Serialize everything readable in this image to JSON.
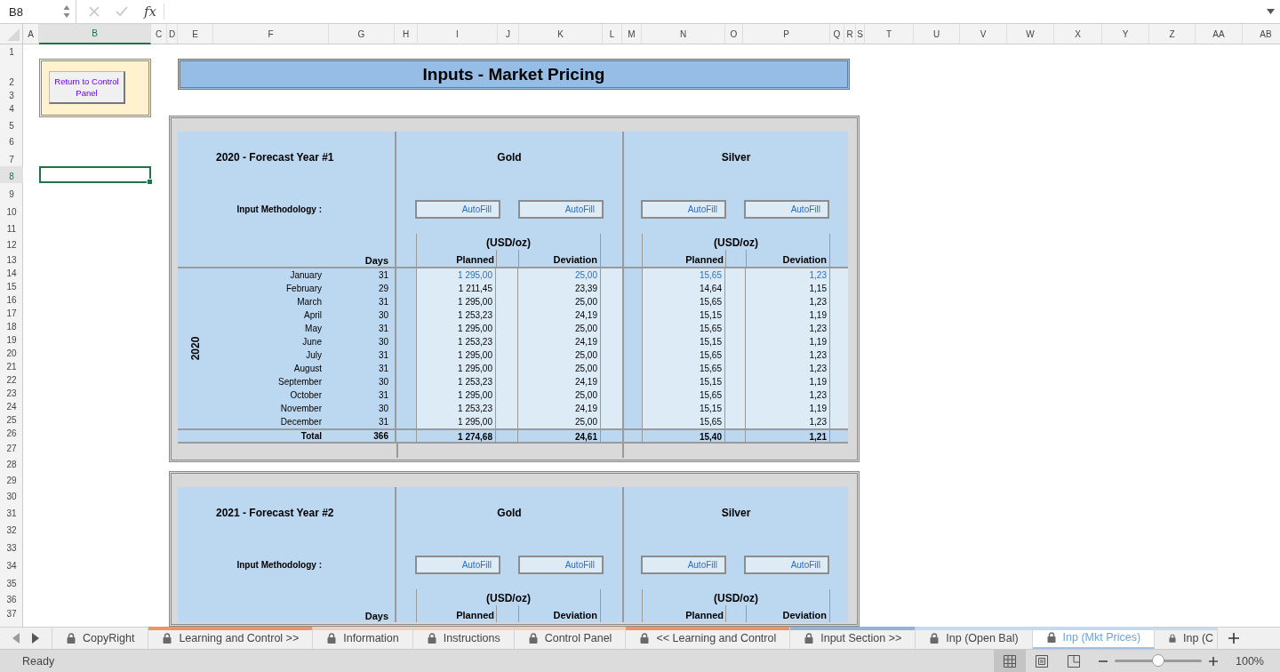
{
  "formula_bar": {
    "name_box": "B8",
    "function_label": "fx"
  },
  "columns": [
    {
      "label": "A",
      "selected": false
    },
    {
      "label": "B",
      "selected": true
    },
    {
      "label": "C",
      "selected": false
    },
    {
      "label": "D",
      "selected": false
    },
    {
      "label": "E",
      "selected": false
    },
    {
      "label": "F",
      "selected": false
    },
    {
      "label": "G",
      "selected": false
    },
    {
      "label": "H",
      "selected": false
    },
    {
      "label": "I",
      "selected": false
    },
    {
      "label": "J",
      "selected": false
    },
    {
      "label": "K",
      "selected": false
    },
    {
      "label": "L",
      "selected": false
    },
    {
      "label": "M",
      "selected": false
    },
    {
      "label": "N",
      "selected": false
    },
    {
      "label": "O",
      "selected": false
    },
    {
      "label": "P",
      "selected": false
    },
    {
      "label": "Q",
      "selected": false
    },
    {
      "label": "R",
      "selected": false
    },
    {
      "label": "S",
      "selected": false
    },
    {
      "label": "T",
      "selected": false
    },
    {
      "label": "U",
      "selected": false
    },
    {
      "label": "V",
      "selected": false
    },
    {
      "label": "W",
      "selected": false
    },
    {
      "label": "X",
      "selected": false
    },
    {
      "label": "Y",
      "selected": false
    },
    {
      "label": "Z",
      "selected": false
    },
    {
      "label": "AA",
      "selected": false
    },
    {
      "label": "AB",
      "selected": false
    }
  ],
  "rows": [
    {
      "label": "1",
      "selected": false
    },
    {
      "label": "2",
      "selected": false
    },
    {
      "label": "3",
      "selected": false
    },
    {
      "label": "4",
      "selected": false
    },
    {
      "label": "5",
      "selected": false
    },
    {
      "label": "6",
      "selected": false
    },
    {
      "label": "7",
      "selected": false
    },
    {
      "label": "8",
      "selected": true
    },
    {
      "label": "9",
      "selected": false
    },
    {
      "label": "10",
      "selected": false
    },
    {
      "label": "11",
      "selected": false
    },
    {
      "label": "12",
      "selected": false
    },
    {
      "label": "13",
      "selected": false
    },
    {
      "label": "14",
      "selected": false
    },
    {
      "label": "15",
      "selected": false
    },
    {
      "label": "16",
      "selected": false
    },
    {
      "label": "17",
      "selected": false
    },
    {
      "label": "18",
      "selected": false
    },
    {
      "label": "19",
      "selected": false
    },
    {
      "label": "20",
      "selected": false
    },
    {
      "label": "21",
      "selected": false
    },
    {
      "label": "22",
      "selected": false
    },
    {
      "label": "23",
      "selected": false
    },
    {
      "label": "24",
      "selected": false
    },
    {
      "label": "25",
      "selected": false
    },
    {
      "label": "26",
      "selected": false
    },
    {
      "label": "27",
      "selected": false
    },
    {
      "label": "28",
      "selected": false
    },
    {
      "label": "29",
      "selected": false
    },
    {
      "label": "30",
      "selected": false
    },
    {
      "label": "31",
      "selected": false
    },
    {
      "label": "32",
      "selected": false
    },
    {
      "label": "33",
      "selected": false
    },
    {
      "label": "34",
      "selected": false
    },
    {
      "label": "35",
      "selected": false
    },
    {
      "label": "36",
      "selected": false
    },
    {
      "label": "37",
      "selected": false
    }
  ],
  "return_button": "Return to Control Panel",
  "title": "Inputs - Market Pricing",
  "blocks": [
    {
      "title": "2020 - Forecast Year #1",
      "methodology_label": "Input Methodology :",
      "days_label": "Days",
      "year_label": "2020",
      "metals": [
        {
          "name": "Gold",
          "autofill": [
            "AutoFill",
            "AutoFill"
          ],
          "unit": "(USD/oz)",
          "columns": [
            "Planned",
            "Deviation"
          ]
        },
        {
          "name": "Silver",
          "autofill": [
            "AutoFill",
            "AutoFill"
          ],
          "unit": "(USD/oz)",
          "columns": [
            "Planned",
            "Deviation"
          ]
        }
      ],
      "rows": [
        {
          "month": "January",
          "days": "31",
          "is_input": true,
          "values": [
            [
              "1 295,00",
              "25,00"
            ],
            [
              "15,65",
              "1,23"
            ]
          ]
        },
        {
          "month": "February",
          "days": "29",
          "is_input": false,
          "values": [
            [
              "1 211,45",
              "23,39"
            ],
            [
              "14,64",
              "1,15"
            ]
          ]
        },
        {
          "month": "March",
          "days": "31",
          "is_input": false,
          "values": [
            [
              "1 295,00",
              "25,00"
            ],
            [
              "15,65",
              "1,23"
            ]
          ]
        },
        {
          "month": "April",
          "days": "30",
          "is_input": false,
          "values": [
            [
              "1 253,23",
              "24,19"
            ],
            [
              "15,15",
              "1,19"
            ]
          ]
        },
        {
          "month": "May",
          "days": "31",
          "is_input": false,
          "values": [
            [
              "1 295,00",
              "25,00"
            ],
            [
              "15,65",
              "1,23"
            ]
          ]
        },
        {
          "month": "June",
          "days": "30",
          "is_input": false,
          "values": [
            [
              "1 253,23",
              "24,19"
            ],
            [
              "15,15",
              "1,19"
            ]
          ]
        },
        {
          "month": "July",
          "days": "31",
          "is_input": false,
          "values": [
            [
              "1 295,00",
              "25,00"
            ],
            [
              "15,65",
              "1,23"
            ]
          ]
        },
        {
          "month": "August",
          "days": "31",
          "is_input": false,
          "values": [
            [
              "1 295,00",
              "25,00"
            ],
            [
              "15,65",
              "1,23"
            ]
          ]
        },
        {
          "month": "September",
          "days": "30",
          "is_input": false,
          "values": [
            [
              "1 253,23",
              "24,19"
            ],
            [
              "15,15",
              "1,19"
            ]
          ]
        },
        {
          "month": "October",
          "days": "31",
          "is_input": false,
          "values": [
            [
              "1 295,00",
              "25,00"
            ],
            [
              "15,65",
              "1,23"
            ]
          ]
        },
        {
          "month": "November",
          "days": "30",
          "is_input": false,
          "values": [
            [
              "1 253,23",
              "24,19"
            ],
            [
              "15,15",
              "1,19"
            ]
          ]
        },
        {
          "month": "December",
          "days": "31",
          "is_input": false,
          "values": [
            [
              "1 295,00",
              "25,00"
            ],
            [
              "15,65",
              "1,23"
            ]
          ]
        }
      ],
      "total": {
        "label": "Total",
        "days": "366",
        "values": [
          [
            "1 274,68",
            "24,61"
          ],
          [
            "15,40",
            "1,21"
          ]
        ]
      }
    },
    {
      "title": "2021 - Forecast Year #2",
      "methodology_label": "Input Methodology :",
      "days_label": "Days",
      "metals": [
        {
          "name": "Gold",
          "autofill": [
            "AutoFill",
            "AutoFill"
          ],
          "unit": "(USD/oz)",
          "columns": [
            "Planned",
            "Deviation"
          ]
        },
        {
          "name": "Silver",
          "autofill": [
            "AutoFill",
            "AutoFill"
          ],
          "unit": "(USD/oz)",
          "columns": [
            "Planned",
            "Deviation"
          ]
        }
      ]
    }
  ],
  "tabs": [
    {
      "label": "CopyRight",
      "selected": false
    },
    {
      "label": "Learning and Control >>",
      "selected": false,
      "color": "#e8956a"
    },
    {
      "label": "Information",
      "selected": false,
      "color": "#f6cdb6"
    },
    {
      "label": "Instructions",
      "selected": false,
      "color": "#f6cdb6"
    },
    {
      "label": "Control Panel",
      "selected": false,
      "color": "#f6cdb6"
    },
    {
      "label": "<< Learning and Control",
      "selected": false,
      "color": "#e8956a"
    },
    {
      "label": "Input Section >>",
      "selected": false,
      "color": "#8fb3d9"
    },
    {
      "label": "Inp (Open Bal)",
      "selected": false,
      "color": "#c6daef"
    },
    {
      "label": "Inp (Mkt Prices)",
      "selected": true,
      "color": "#c6daef"
    },
    {
      "label": "Inp (C",
      "selected": false,
      "color": "#c6daef"
    }
  ],
  "status_bar": {
    "status": "Ready",
    "views": [
      {
        "kind": "normal",
        "selected": true
      },
      {
        "kind": "page_layout",
        "selected": false
      },
      {
        "kind": "page_break",
        "selected": false
      }
    ],
    "zoom": {
      "level": 0.5,
      "reading": "100%"
    }
  }
}
